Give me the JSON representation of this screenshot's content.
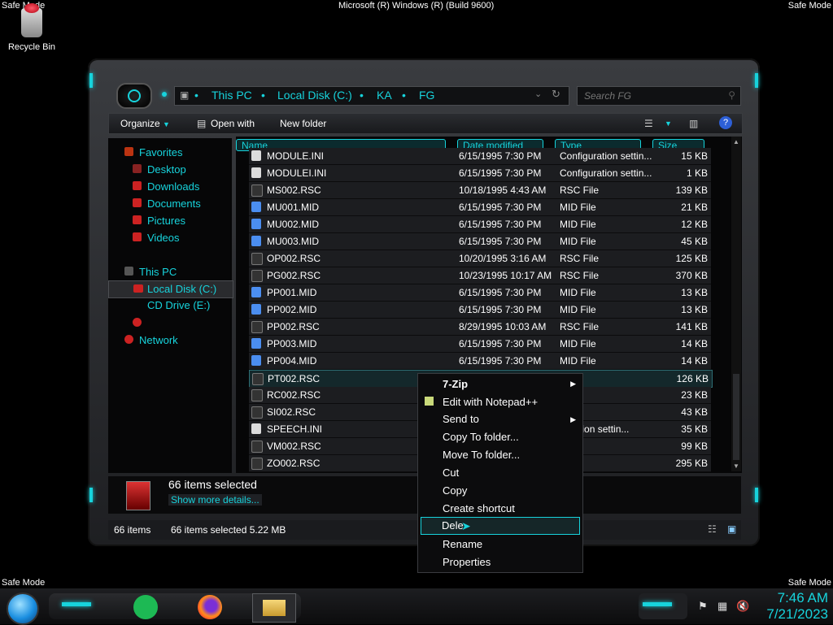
{
  "system": {
    "safe_mode": "Safe Mode",
    "title": "Microsoft (R) Windows (R) (Build 9600)"
  },
  "desktop": {
    "recycle_bin": "Recycle Bin"
  },
  "address": {
    "this_pc": "This PC",
    "local_disk": "Local Disk (C:)",
    "ka": "KA",
    "fg": "FG"
  },
  "search": {
    "placeholder": "Search FG"
  },
  "toolbar": {
    "organize": "Organize",
    "open_with": "Open with",
    "new_folder": "New folder"
  },
  "nav": {
    "favorites": "Favorites",
    "desktop": "Desktop",
    "downloads": "Downloads",
    "documents": "Documents",
    "pictures": "Pictures",
    "videos": "Videos",
    "this_pc": "This PC",
    "local_disk": "Local Disk (C:)",
    "cd_drive": "CD Drive (E:)",
    "network": "Network"
  },
  "columns": {
    "name": "Name",
    "date": "Date modified",
    "type": "Type",
    "size": "Size"
  },
  "files": [
    {
      "name": "MODULE.INI",
      "date": "6/15/1995 7:30 PM",
      "type": "Configuration settin...",
      "size": "15 KB",
      "kind": "ini"
    },
    {
      "name": "MODULEI.INI",
      "date": "6/15/1995 7:30 PM",
      "type": "Configuration settin...",
      "size": "1 KB",
      "kind": "ini"
    },
    {
      "name": "MS002.RSC",
      "date": "10/18/1995 4:43 AM",
      "type": "RSC File",
      "size": "139 KB",
      "kind": "rsc"
    },
    {
      "name": "MU001.MID",
      "date": "6/15/1995 7:30 PM",
      "type": "MID File",
      "size": "21 KB",
      "kind": "mid"
    },
    {
      "name": "MU002.MID",
      "date": "6/15/1995 7:30 PM",
      "type": "MID File",
      "size": "12 KB",
      "kind": "mid"
    },
    {
      "name": "MU003.MID",
      "date": "6/15/1995 7:30 PM",
      "type": "MID File",
      "size": "45 KB",
      "kind": "mid"
    },
    {
      "name": "OP002.RSC",
      "date": "10/20/1995 3:16 AM",
      "type": "RSC File",
      "size": "125 KB",
      "kind": "rsc"
    },
    {
      "name": "PG002.RSC",
      "date": "10/23/1995 10:17 AM",
      "type": "RSC File",
      "size": "370 KB",
      "kind": "rsc"
    },
    {
      "name": "PP001.MID",
      "date": "6/15/1995 7:30 PM",
      "type": "MID File",
      "size": "13 KB",
      "kind": "mid"
    },
    {
      "name": "PP002.MID",
      "date": "6/15/1995 7:30 PM",
      "type": "MID File",
      "size": "13 KB",
      "kind": "mid"
    },
    {
      "name": "PP002.RSC",
      "date": "8/29/1995 10:03 AM",
      "type": "RSC File",
      "size": "141 KB",
      "kind": "rsc"
    },
    {
      "name": "PP003.MID",
      "date": "6/15/1995 7:30 PM",
      "type": "MID File",
      "size": "14 KB",
      "kind": "mid"
    },
    {
      "name": "PP004.MID",
      "date": "6/15/1995 7:30 PM",
      "type": "MID File",
      "size": "14 KB",
      "kind": "mid"
    },
    {
      "name": "PT002.RSC",
      "date": "",
      "type": "ile",
      "size": "126 KB",
      "kind": "rsc"
    },
    {
      "name": "RC002.RSC",
      "date": "",
      "type": "ile",
      "size": "23 KB",
      "kind": "rsc"
    },
    {
      "name": "SI002.RSC",
      "date": "",
      "type": "ile",
      "size": "43 KB",
      "kind": "rsc"
    },
    {
      "name": "SPEECH.INI",
      "date": "",
      "type": "guration settin...",
      "size": "35 KB",
      "kind": "ini"
    },
    {
      "name": "VM002.RSC",
      "date": "",
      "type": "ile",
      "size": "99 KB",
      "kind": "rsc"
    },
    {
      "name": "ZO002.RSC",
      "date": "",
      "type": "ile",
      "size": "295 KB",
      "kind": "rsc"
    }
  ],
  "details": {
    "selected": "66 items selected",
    "show_more": "Show more details..."
  },
  "status": {
    "count": "66 items",
    "selected": "66 items selected  5.22 MB"
  },
  "context_menu": {
    "zip": "7-Zip",
    "notepad": "Edit with Notepad++",
    "send_to": "Send to",
    "copy_to": "Copy To folder...",
    "move_to": "Move To folder...",
    "cut": "Cut",
    "copy": "Copy",
    "shortcut": "Create shortcut",
    "delete": "Dele",
    "rename": "Rename",
    "properties": "Properties"
  },
  "clock": {
    "time": "7:46 AM",
    "date": "7/21/2023"
  },
  "colors": {
    "accent": "#17d3dc"
  }
}
